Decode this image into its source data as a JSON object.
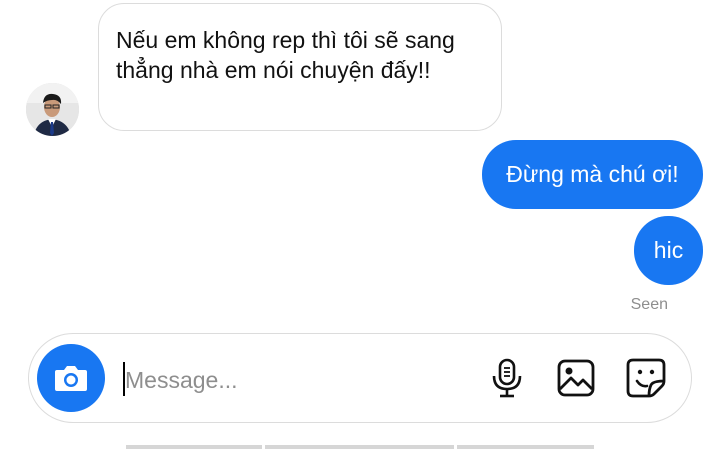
{
  "conversation": {
    "incoming": [
      {
        "text": "Nếu em không rep thì tôi sẽ sang thẳng nhà em nói chuyện đấy!!"
      }
    ],
    "outgoing": [
      {
        "text": "Đừng mà chú ơi!"
      },
      {
        "text": "hic"
      }
    ],
    "status": "Seen"
  },
  "composer": {
    "placeholder": "Message...",
    "value": ""
  },
  "icons": {
    "camera": "camera-icon",
    "mic": "microphone-icon",
    "gallery": "image-icon",
    "sticker": "sticker-icon"
  },
  "colors": {
    "accent": "#1877f2",
    "incoming_border": "#dcdcdc",
    "muted_text": "#8e8e8e"
  }
}
